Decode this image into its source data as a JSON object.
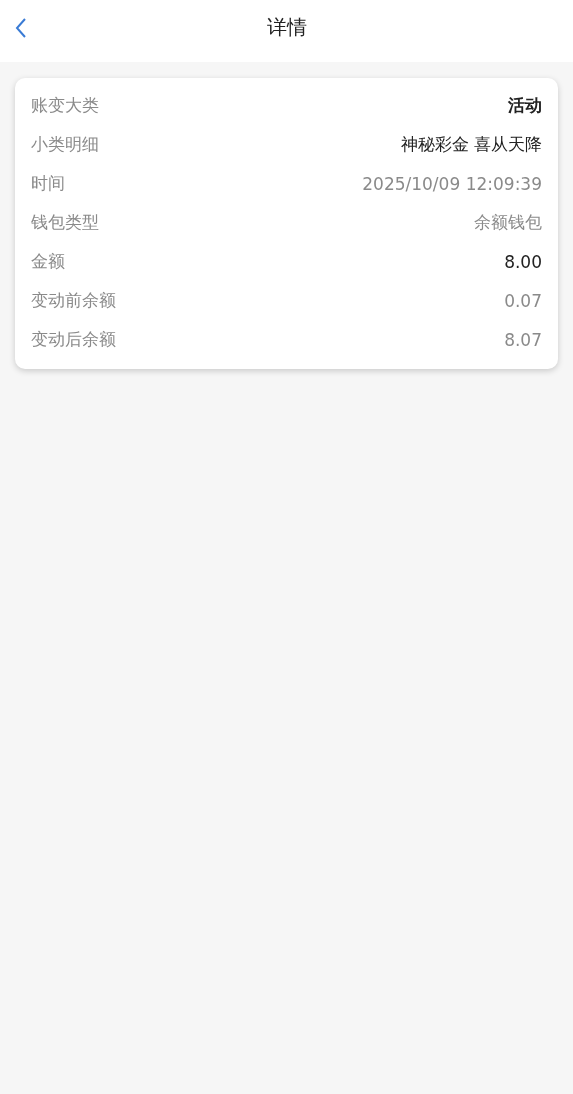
{
  "header": {
    "title": "详情"
  },
  "details": [
    {
      "label": "账变大类",
      "value": "活动",
      "kind": "bold"
    },
    {
      "label": "小类明细",
      "value": "神秘彩金 喜从天降",
      "kind": "dark"
    },
    {
      "label": "时间",
      "value": "2025/10/09 12:09:39",
      "kind": "muted"
    },
    {
      "label": "钱包类型",
      "value": "余额钱包",
      "kind": "muted"
    },
    {
      "label": "金额",
      "value": "8.00",
      "kind": "dark"
    },
    {
      "label": "变动前余额",
      "value": "0.07",
      "kind": "muted"
    },
    {
      "label": "变动后余额",
      "value": "8.07",
      "kind": "muted"
    }
  ]
}
